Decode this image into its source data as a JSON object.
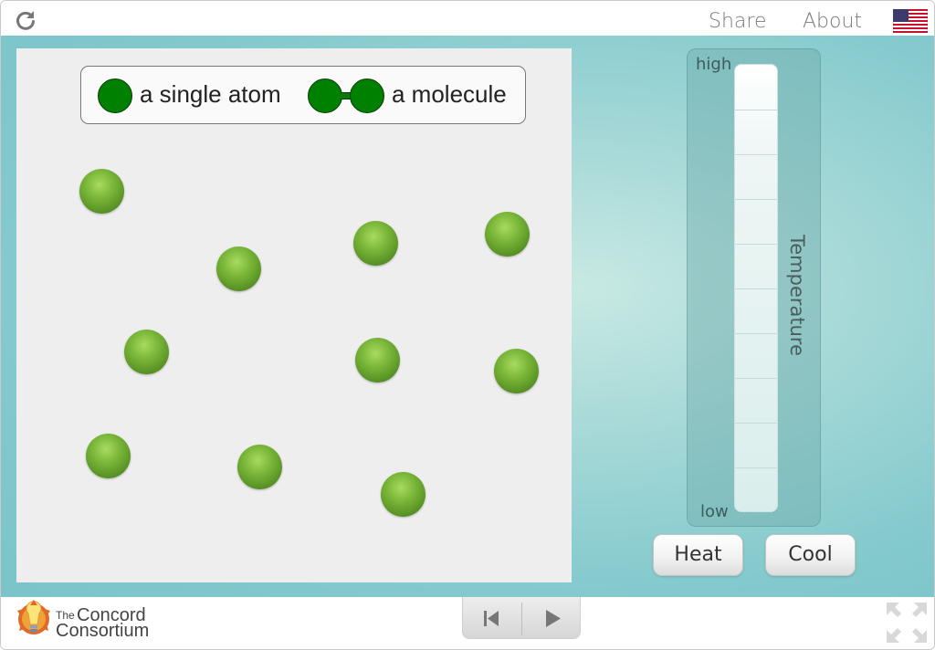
{
  "topbar": {
    "reload_icon": "reload-icon",
    "share_label": "Share",
    "about_label": "About",
    "language_icon": "us-flag-icon"
  },
  "legend": {
    "atom_label": "a single atom",
    "molecule_label": "a molecule",
    "atom_color": "#008000"
  },
  "model": {
    "atom_count": 10,
    "atom_color": "#6ea830"
  },
  "thermometer": {
    "high_label": "high",
    "low_label": "low",
    "title": "Temperature"
  },
  "controls": {
    "heat_label": "Heat",
    "cool_label": "Cool"
  },
  "footer": {
    "logo_the": "The",
    "logo_concord": "Concord",
    "logo_consortium": "Consortium",
    "reset_icon": "step-back-icon",
    "play_icon": "play-icon",
    "fullscreen_icon": "fullscreen-icon"
  },
  "colors": {
    "stage_bg": "#8fcfd1",
    "panel_bg": "#eeeeee"
  }
}
